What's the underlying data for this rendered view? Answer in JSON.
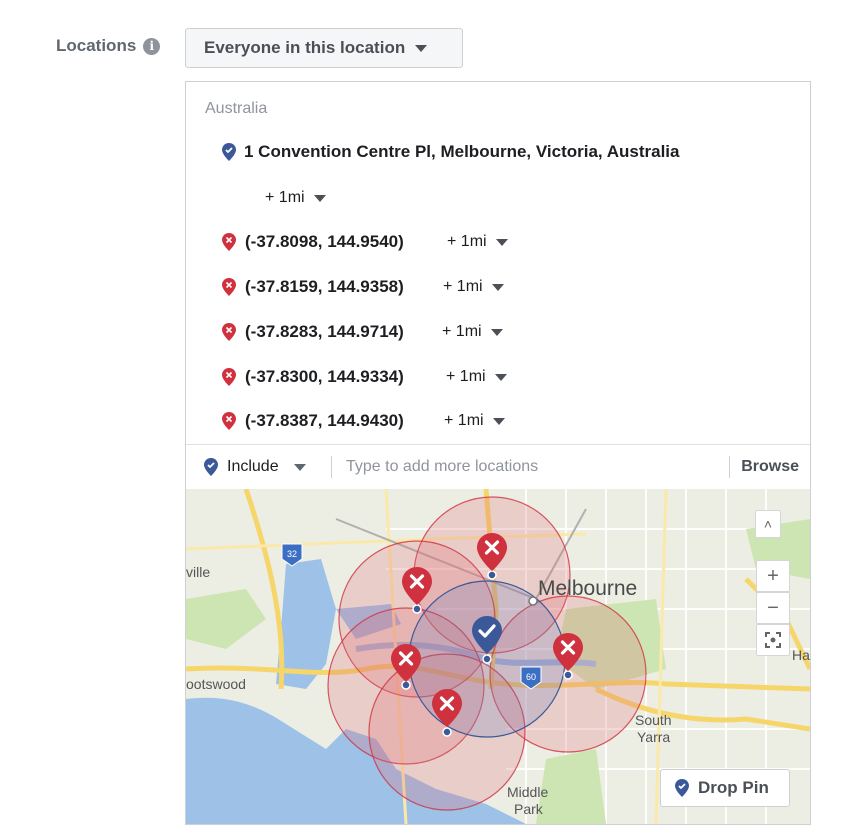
{
  "locations": {
    "label": "Locations",
    "info_icon": "i",
    "audience_dropdown": "Everyone in this location"
  },
  "panel": {
    "country": "Australia",
    "primary": {
      "address": "1 Convention Centre Pl, Melbourne, Victoria, Australia",
      "radius": "+ 1mi",
      "icon": "include-pin-icon"
    },
    "excluded": [
      {
        "coord": "(-37.8098, 144.9540)",
        "radius": "+ 1mi"
      },
      {
        "coord": "(-37.8159, 144.9358)",
        "radius": "+ 1mi"
      },
      {
        "coord": "(-37.8283, 144.9714)",
        "radius": "+ 1mi"
      },
      {
        "coord": "(-37.8300, 144.9334)",
        "radius": "+ 1mi"
      },
      {
        "coord": "(-37.8387, 144.9430)",
        "radius": "+ 1mi"
      }
    ]
  },
  "input_bar": {
    "include_label": "Include",
    "placeholder": "Type to add more locations",
    "browse_label": "Browse"
  },
  "map": {
    "labels": {
      "melbourne": "Melbourne",
      "south_yarra_1": "South",
      "south_yarra_2": "Yarra",
      "middle_park_1": "Middle",
      "middle_park_2": "Park",
      "footscray": "ootswood",
      "ville": "ville",
      "h_edge": "Ha",
      "route_32": "32",
      "route_60": "60"
    },
    "zoom_in": "+",
    "zoom_out": "−",
    "collapse": "˄",
    "drop_pin_label": "Drop Pin"
  },
  "colors": {
    "include_blue": "#3b5998",
    "exclude_red": "#d0313e",
    "water": "#9ec1e8",
    "road": "#f6d66a"
  }
}
